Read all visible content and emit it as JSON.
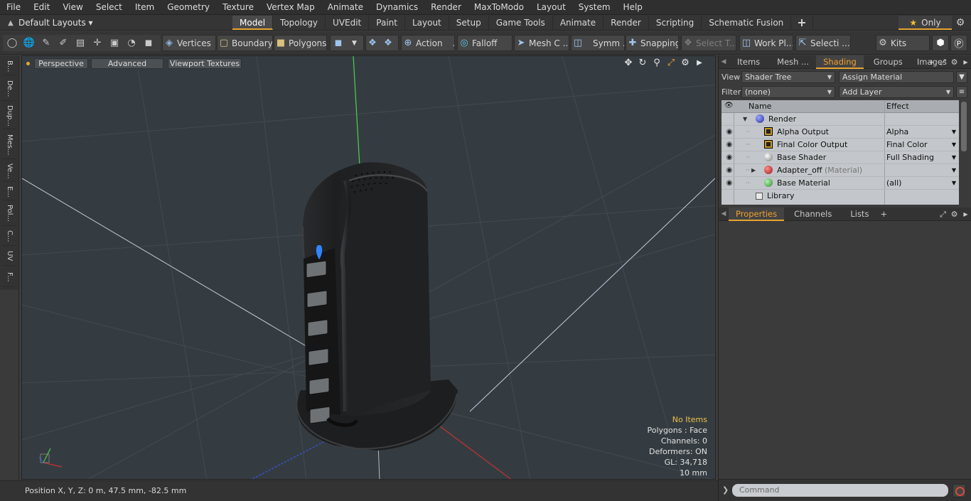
{
  "menu": [
    "File",
    "Edit",
    "View",
    "Select",
    "Item",
    "Geometry",
    "Texture",
    "Vertex Map",
    "Animate",
    "Dynamics",
    "Render",
    "MaxToModo",
    "Layout",
    "System",
    "Help"
  ],
  "layout_selector": "Default Layouts ▾",
  "tabs": [
    "Model",
    "Topology",
    "UVEdit",
    "Paint",
    "Layout",
    "Setup",
    "Game Tools",
    "Animate",
    "Render",
    "Scripting",
    "Schematic Fusion"
  ],
  "active_tab": "Model",
  "only_label": "Only",
  "toolbar": {
    "vertices": "Vertices",
    "boundary": "Boundary",
    "polygons": "Polygons",
    "action": "Action",
    "falloff": "Falloff",
    "mesh_c": "Mesh C ...",
    "symm": "Symm ...",
    "snapping": "Snapping",
    "select_t": "Select T...",
    "work_pl": "Work Pl...",
    "selecti": "Selecti ...",
    "kits": "Kits"
  },
  "left_tabs": [
    "B...",
    "De...",
    "Dup...",
    "Mes...",
    "Ve...",
    "E...",
    "Pol...",
    "C...",
    "UV",
    "F..."
  ],
  "viewport": {
    "perspective": "Perspective",
    "advanced": "Advanced",
    "viewport_textures": "Viewport Textures",
    "info": {
      "items": "No Items",
      "polygons": "Polygons : Face",
      "channels": "Channels: 0",
      "deformers": "Deformers: ON",
      "gl": "GL: 34,718",
      "scale": "10 mm"
    },
    "accent_color": "#e6a532"
  },
  "status": {
    "position": "Position X, Y, Z:   0 m, 47.5 mm, -82.5 mm"
  },
  "panel_tabs": [
    "Items",
    "Mesh ...",
    "Shading",
    "Groups",
    "Images"
  ],
  "panel_active": "Shading",
  "shading": {
    "view_label": "View",
    "view_value": "Shader Tree",
    "assign_material": "Assign Material",
    "filter_label": "Filter",
    "filter_value": "(none)",
    "add_layer": "Add Layer",
    "col_name": "Name",
    "col_effect": "Effect",
    "rows": [
      {
        "name": "Render",
        "suffix": "",
        "effect": ""
      },
      {
        "name": "Alpha Output",
        "suffix": "",
        "effect": "Alpha"
      },
      {
        "name": "Final Color Output",
        "suffix": "",
        "effect": "Final Color"
      },
      {
        "name": "Base Shader",
        "suffix": "",
        "effect": "Full Shading"
      },
      {
        "name": "Adapter_off",
        "suffix": "(Material)",
        "effect": ""
      },
      {
        "name": "Base Material",
        "suffix": "",
        "effect": "(all)"
      },
      {
        "name": "Library",
        "suffix": "",
        "effect": ""
      }
    ]
  },
  "lower_tabs": [
    "Properties",
    "Channels",
    "Lists"
  ],
  "lower_active": "Properties",
  "command": {
    "placeholder": "Command"
  }
}
